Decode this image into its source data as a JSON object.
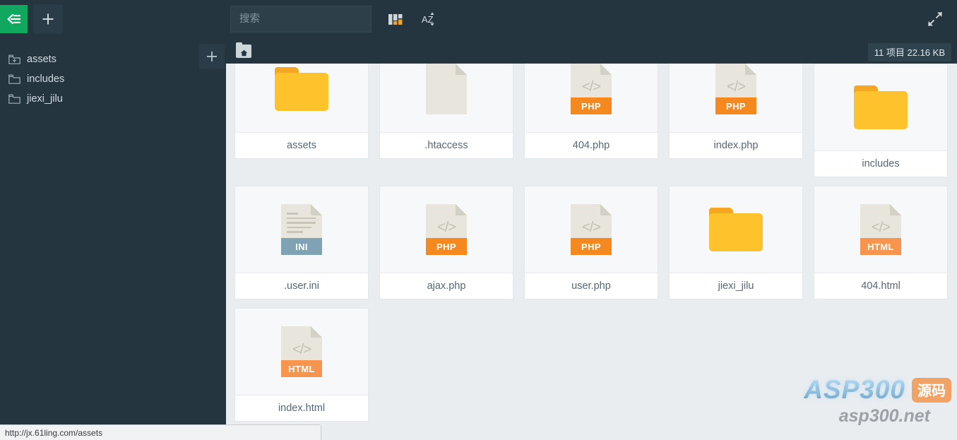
{
  "toolbar": {
    "back_label": "back",
    "add_label": "+",
    "search_placeholder": "搜索",
    "search_value": "",
    "columns_label": "columns-view",
    "sort_label": "sort-az",
    "fullscreen_label": "fullscreen"
  },
  "sidebar": {
    "add_label": "+",
    "items": [
      {
        "label": "assets",
        "icon": "folder-plus-icon",
        "expandable": true
      },
      {
        "label": "includes",
        "icon": "folder-icon",
        "expandable": false
      },
      {
        "label": "jiexi_jilu",
        "icon": "folder-icon",
        "expandable": false
      }
    ]
  },
  "breadcrumb": {
    "home_label": "home",
    "meta": "11 项目  22.16 KB"
  },
  "files": [
    {
      "name": "assets",
      "type": "folder",
      "badge": ""
    },
    {
      "name": ".htaccess",
      "type": "plain",
      "badge": ""
    },
    {
      "name": "404.php",
      "type": "code",
      "badge": "PHP"
    },
    {
      "name": "index.php",
      "type": "code",
      "badge": "PHP"
    },
    {
      "name": "includes",
      "type": "folder",
      "badge": ""
    },
    {
      "name": ".user.ini",
      "type": "text",
      "badge": "INI"
    },
    {
      "name": "ajax.php",
      "type": "code",
      "badge": "PHP"
    },
    {
      "name": "user.php",
      "type": "code",
      "badge": "PHP"
    },
    {
      "name": "jiexi_jilu",
      "type": "folder",
      "badge": ""
    },
    {
      "name": "404.html",
      "type": "code",
      "badge": "HTML"
    },
    {
      "name": "index.html",
      "type": "code",
      "badge": "HTML"
    }
  ],
  "status": {
    "url": "http://jx.61ling.com/assets"
  },
  "watermark": {
    "main": "ASP300",
    "badge": "源码",
    "sub": "asp300.net"
  },
  "colors": {
    "chrome": "#243540",
    "accent_green": "#0fa85e",
    "canvas": "#e9edf0",
    "folder": "#fec22d",
    "php_band": "#f68820",
    "html_band": "#f7954e",
    "ini_band": "#7fa3b4"
  }
}
